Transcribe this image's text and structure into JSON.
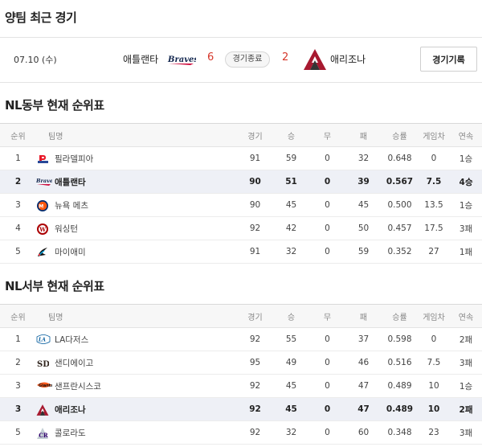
{
  "recent": {
    "title": "양팀 최근 경기",
    "date": "07.10 (수)",
    "home_team": "애틀랜타",
    "home_score": "6",
    "status": "경기종료",
    "away_score": "2",
    "away_team": "애리조나",
    "record_button": "경기기록"
  },
  "columns": [
    "순위",
    "팀명",
    "경기",
    "승",
    "무",
    "패",
    "승률",
    "게임차",
    "연속"
  ],
  "east": {
    "title": "NL동부 현재 순위표",
    "rows": [
      {
        "rank": "1",
        "team": "필라델피아",
        "logo": "phillies-logo",
        "g": "91",
        "w": "59",
        "d": "0",
        "l": "32",
        "pct": "0.648",
        "gb": "0",
        "streak": "1승"
      },
      {
        "rank": "2",
        "team": "애틀랜타",
        "logo": "braves-logo",
        "g": "90",
        "w": "51",
        "d": "0",
        "l": "39",
        "pct": "0.567",
        "gb": "7.5",
        "streak": "4승"
      },
      {
        "rank": "3",
        "team": "뉴욕 메츠",
        "logo": "mets-logo",
        "g": "90",
        "w": "45",
        "d": "0",
        "l": "45",
        "pct": "0.500",
        "gb": "13.5",
        "streak": "1승"
      },
      {
        "rank": "4",
        "team": "워싱턴",
        "logo": "nationals-logo",
        "g": "92",
        "w": "42",
        "d": "0",
        "l": "50",
        "pct": "0.457",
        "gb": "17.5",
        "streak": "3패"
      },
      {
        "rank": "5",
        "team": "마이애미",
        "logo": "marlins-logo",
        "g": "91",
        "w": "32",
        "d": "0",
        "l": "59",
        "pct": "0.352",
        "gb": "27",
        "streak": "1패"
      }
    ]
  },
  "west": {
    "title": "NL서부 현재 순위표",
    "rows": [
      {
        "rank": "1",
        "team": "LA다저스",
        "logo": "dodgers-logo",
        "g": "92",
        "w": "55",
        "d": "0",
        "l": "37",
        "pct": "0.598",
        "gb": "0",
        "streak": "2패"
      },
      {
        "rank": "2",
        "team": "샌디에이고",
        "logo": "padres-logo",
        "g": "95",
        "w": "49",
        "d": "0",
        "l": "46",
        "pct": "0.516",
        "gb": "7.5",
        "streak": "3패"
      },
      {
        "rank": "3",
        "team": "샌프란시스코",
        "logo": "giants-logo",
        "g": "92",
        "w": "45",
        "d": "0",
        "l": "47",
        "pct": "0.489",
        "gb": "10",
        "streak": "1승"
      },
      {
        "rank": "3",
        "team": "애리조나",
        "logo": "diamondbacks-logo",
        "g": "92",
        "w": "45",
        "d": "0",
        "l": "47",
        "pct": "0.489",
        "gb": "10",
        "streak": "2패"
      },
      {
        "rank": "5",
        "team": "콜로라도",
        "logo": "rockies-logo",
        "g": "92",
        "w": "32",
        "d": "0",
        "l": "60",
        "pct": "0.348",
        "gb": "23",
        "streak": "3패"
      }
    ]
  },
  "highlighted_rows": {
    "east": 1,
    "west": 3
  },
  "colors": {
    "score": "#d6372b",
    "highlight_row": "#eef0f6",
    "header_bg": "#f7f7f7"
  }
}
